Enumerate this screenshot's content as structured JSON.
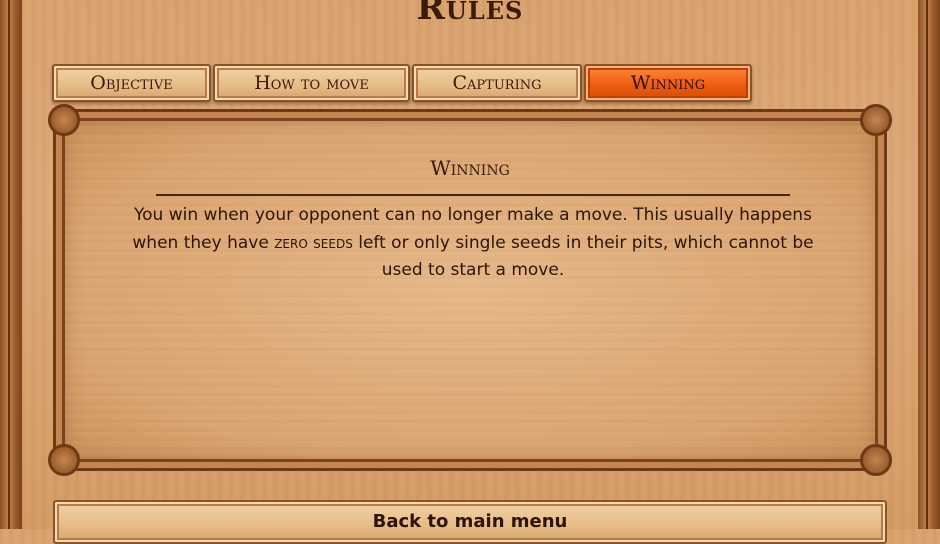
{
  "title": "Rules",
  "tabs": [
    {
      "label": "Objective",
      "active": false
    },
    {
      "label": "How to move",
      "active": false
    },
    {
      "label": "Capturing",
      "active": false
    },
    {
      "label": "Winning",
      "active": true
    }
  ],
  "panel": {
    "heading": "Winning",
    "text_part1": "You win when your opponent can no longer make a move. This usually happens when they have ",
    "highlight": "zero seeds",
    "text_part2": " left or only single seeds in their pits, which cannot be used to start a move."
  },
  "back_button": "Back to main menu",
  "colors": {
    "active_tab": "#ef5d12",
    "wood": "#d9a470",
    "text": "#2e1407"
  }
}
